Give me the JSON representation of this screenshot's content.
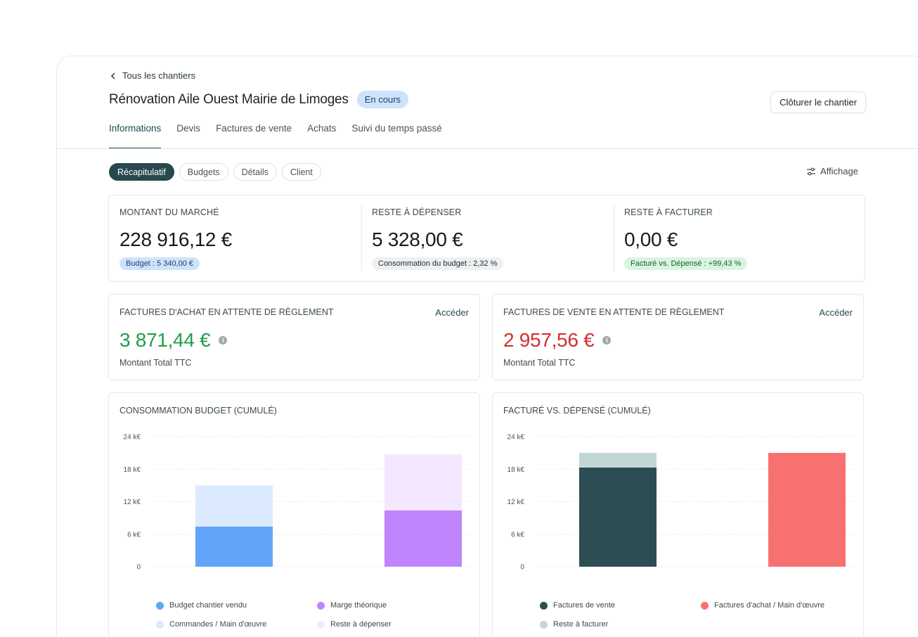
{
  "nav": {
    "back_label": "Tous les chantiers"
  },
  "header": {
    "title": "Rénovation Aile Ouest Mairie de Limoges",
    "status": "En cours",
    "close_button": "Clôturer le chantier"
  },
  "tabs": [
    {
      "label": "Informations",
      "active": true
    },
    {
      "label": "Devis",
      "active": false
    },
    {
      "label": "Factures de vente",
      "active": false
    },
    {
      "label": "Achats",
      "active": false
    },
    {
      "label": "Suivi du temps passé",
      "active": false
    }
  ],
  "subtabs": [
    {
      "label": "Récapitulatif",
      "active": true
    },
    {
      "label": "Budgets",
      "active": false
    },
    {
      "label": "Détails",
      "active": false
    },
    {
      "label": "Client",
      "active": false
    }
  ],
  "display_button": "Affichage",
  "kpis": [
    {
      "label": "MONTANT DU MARCHÉ",
      "value": "228 916,12 €",
      "pill": "Budget : 5 340,00 €",
      "pill_bg": "#cfe2fb",
      "pill_color": "#21416b"
    },
    {
      "label": "RESTE À DÉPENSER",
      "value": "5 328,00 €",
      "pill": "Consommation du budget : 2,32 %",
      "pill_bg": "#eef0f1",
      "pill_color": "#1f2a2e"
    },
    {
      "label": "RESTE À FACTURER",
      "value": "0,00 €",
      "pill": "Facturé vs. Dépensé : +99,43 %",
      "pill_bg": "#d8f5df",
      "pill_color": "#1e5a30"
    }
  ],
  "pending": [
    {
      "label": "FACTURES D'ACHAT EN ATTENTE DE RÈGLEMENT",
      "link": "Accéder",
      "value": "3 871,44 €",
      "value_color": "#1e9e4a",
      "sub": "Montant Total TTC"
    },
    {
      "label": "FACTURES DE VENTE EN ATTENTE DE RÈGLEMENT",
      "link": "Accéder",
      "value": "2 957,56 €",
      "value_color": "#d32f2f",
      "sub": "Montant Total TTC"
    }
  ],
  "chart_data": [
    {
      "type": "bar",
      "title": "CONSOMMATION BUDGET (CUMULÉ)",
      "y_ticks": [
        "24 k€",
        "18 k€",
        "12  k€",
        "6  k€",
        "0"
      ],
      "ylim": [
        0,
        24
      ],
      "stacked": true,
      "bars": [
        {
          "segments": [
            {
              "name": "Budget chantier vendu",
              "value": 7.4,
              "color": "#60a5fa"
            },
            {
              "name": "Commandes / Main d'œuvre",
              "value": 7.6,
              "color": "#dbeafe"
            }
          ]
        },
        {
          "segments": [
            {
              "name": "Marge théorique",
              "value": 10.4,
              "color": "#c084fc"
            },
            {
              "name": "Reste à dépenser",
              "value": 10.3,
              "color": "#f3e8ff"
            }
          ]
        }
      ],
      "legend": [
        {
          "label": "Budget chantier vendu",
          "color": "#60a5fa"
        },
        {
          "label": "Marge théorique",
          "color": "#c084fc"
        },
        {
          "label": "Commandes / Main d'œuvre",
          "color": "#dbeafe"
        },
        {
          "label": "Reste à dépenser",
          "color": "#f3e8ff"
        }
      ]
    },
    {
      "type": "bar",
      "title": "FACTURÉ VS. DÉPENSÉ (CUMULÉ)",
      "y_ticks": [
        "24 k€",
        "18 k€",
        "12  k€",
        "6  k€",
        "0"
      ],
      "ylim": [
        0,
        24
      ],
      "stacked": true,
      "bars": [
        {
          "segments": [
            {
              "name": "Factures de vente",
              "value": 18.3,
              "color": "#2b4d53"
            },
            {
              "name": "Reste à facturer",
              "value": 2.7,
              "color": "#c3d6d6"
            }
          ]
        },
        {
          "segments": [
            {
              "name": "Factures d'achat / Main d'œuvre",
              "value": 21.0,
              "color": "#f87171"
            }
          ]
        }
      ],
      "legend": [
        {
          "label": "Factures de vente",
          "color": "#2b4d53"
        },
        {
          "label": "Factures d'achat / Main d'œuvre",
          "color": "#f87171"
        },
        {
          "label": "Reste à facturer",
          "color": "#c3d6d6"
        }
      ]
    }
  ]
}
